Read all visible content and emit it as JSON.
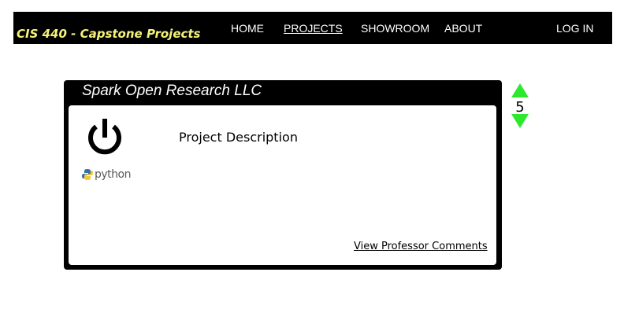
{
  "header": {
    "brand": "CIS 440 - Capstone Projects",
    "nav": [
      "HOME",
      "PROJECTS",
      "SHOWROOM",
      "ABOUT"
    ],
    "active_nav": "PROJECTS",
    "login": "LOG IN"
  },
  "project": {
    "title": "Spark Open Research LLC",
    "description_label": "Project Description",
    "comments_link": "View Professor Comments",
    "votes": "5",
    "logo_icon": "power-icon",
    "tech_logo_text": "python"
  },
  "colors": {
    "navbar_bg": "#000000",
    "brand_text": "#f5f27a",
    "vote_arrow": "#2ee82e"
  }
}
